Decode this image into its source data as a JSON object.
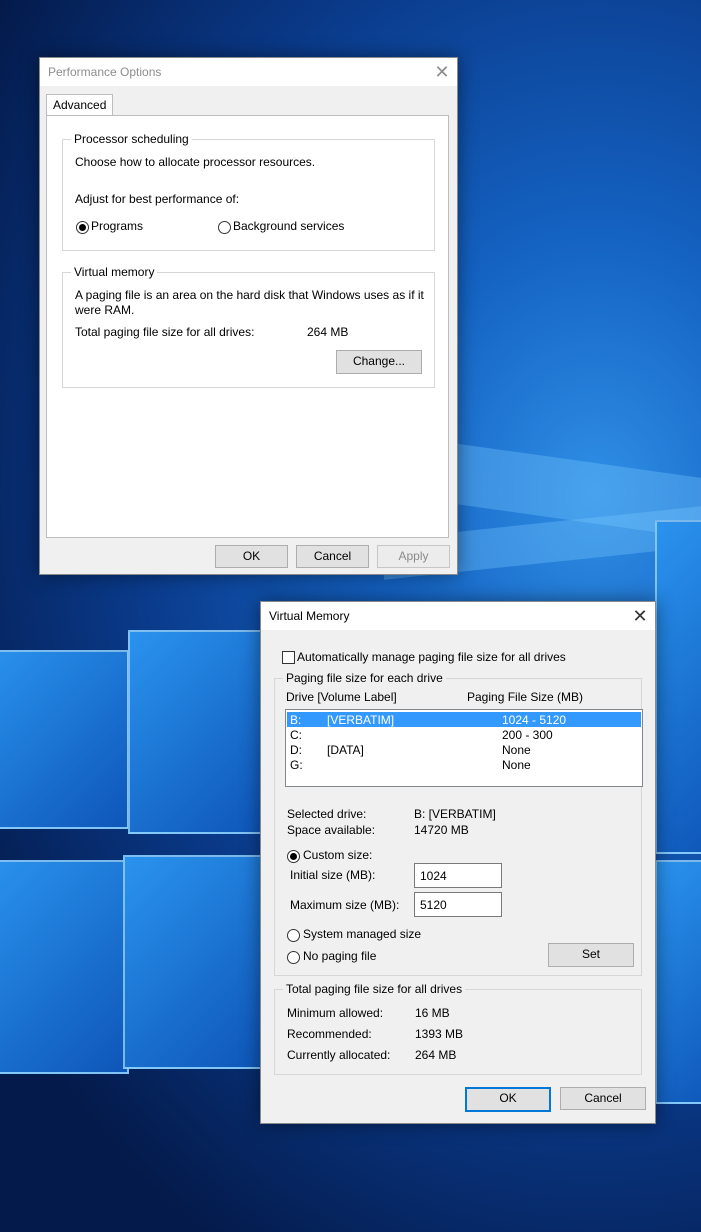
{
  "perf": {
    "title": "Performance Options",
    "tab": "Advanced",
    "processor": {
      "legend": "Processor scheduling",
      "desc": "Choose how to allocate processor resources.",
      "adjust": "Adjust for best performance of:",
      "programs": "Programs",
      "background": "Background services",
      "selected": "Programs"
    },
    "vm": {
      "legend": "Virtual memory",
      "desc1": "A paging file is an area on the hard disk that Windows uses as if it",
      "desc2": "were RAM.",
      "total_label": "Total paging file size for all drives:",
      "total_value": "264 MB",
      "change": "Change..."
    },
    "ok": "OK",
    "cancel": "Cancel",
    "apply": "Apply"
  },
  "vmwin": {
    "title": "Virtual Memory",
    "auto_label": "Automatically manage paging file size for all drives",
    "auto_checked": false,
    "group_label": "Paging file size for each drive",
    "col_drive": "Drive  [Volume Label]",
    "col_size": "Paging File Size (MB)",
    "drives": [
      {
        "drive": "B:",
        "label": "[VERBATIM]",
        "size": "1024 - 5120",
        "selected": true
      },
      {
        "drive": "C:",
        "label": "",
        "size": "200 - 300",
        "selected": false
      },
      {
        "drive": "D:",
        "label": "[DATA]",
        "size": "None",
        "selected": false
      },
      {
        "drive": "G:",
        "label": "",
        "size": "None",
        "selected": false
      }
    ],
    "selected_drive_label": "Selected drive:",
    "selected_drive_value": "B:  [VERBATIM]",
    "space_label": "Space available:",
    "space_value": "14720 MB",
    "custom_label": "Custom size:",
    "initial_label": "Initial size (MB):",
    "initial_value": "1024",
    "max_label": "Maximum size (MB):",
    "max_value": "5120",
    "system_label": "System managed size",
    "nopaging_label": "No paging file",
    "set": "Set",
    "totals": {
      "legend": "Total paging file size for all drives",
      "min_label": "Minimum allowed:",
      "min_value": "16 MB",
      "rec_label": "Recommended:",
      "rec_value": "1393 MB",
      "cur_label": "Currently allocated:",
      "cur_value": "264 MB"
    },
    "ok": "OK",
    "cancel": "Cancel"
  }
}
